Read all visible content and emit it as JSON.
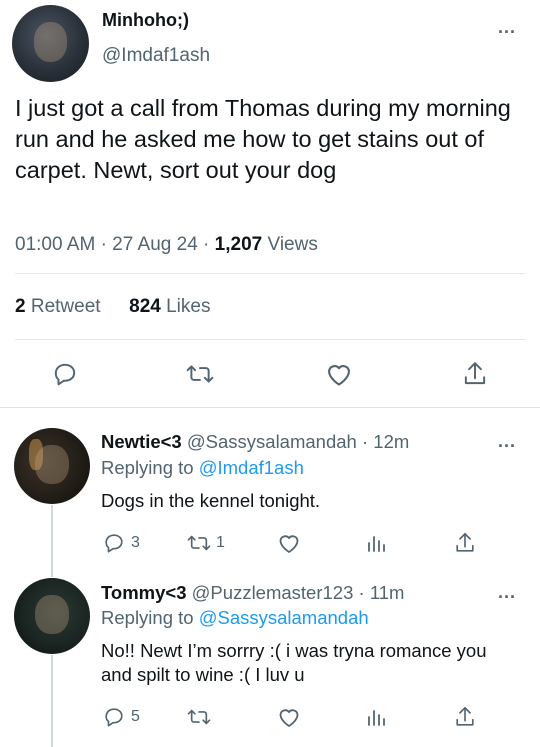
{
  "main_tweet": {
    "author_name": "Minhoho;)",
    "author_handle": "@Imdaf1ash",
    "text": "I just got a call from Thomas during my morning run and he asked me how to get stains out of carpet. Newt, sort out your dog",
    "time": "01:00 AM",
    "date": "27 Aug 24",
    "views_count": "1,207",
    "views_label": "Views",
    "retweet_count": "2",
    "retweet_label": "Retweet",
    "likes_count": "824",
    "likes_label": "Likes",
    "more_icon": "..."
  },
  "replies": [
    {
      "author_name": "Newtie<3",
      "author_handle": "@Sassysalamandah",
      "time_ago": "12m",
      "replying_prefix": "Replying to",
      "replying_to": "@Imdaf1ash",
      "text": "Dogs in the kennel tonight.",
      "reply_count": "3",
      "retweet_count": "1",
      "more_icon": "..."
    },
    {
      "author_name": "Tommy<3",
      "author_handle": "@Puzzlemaster123",
      "time_ago": "11m",
      "replying_prefix": "Replying to",
      "replying_to": "@Sassysalamandah",
      "text": "No!! Newt I’m sorrry :( i was tryna romance you and spilt to wine :( I luv u",
      "reply_count": "5",
      "more_icon": "..."
    }
  ],
  "icons": [
    "reply-icon",
    "retweet-icon",
    "like-icon",
    "share-icon",
    "analytics-icon",
    "more-icon"
  ],
  "colors": {
    "text": "#0f1419",
    "secondary": "#536471",
    "link": "#1d9bf0",
    "divider": "#e4e8eb"
  }
}
